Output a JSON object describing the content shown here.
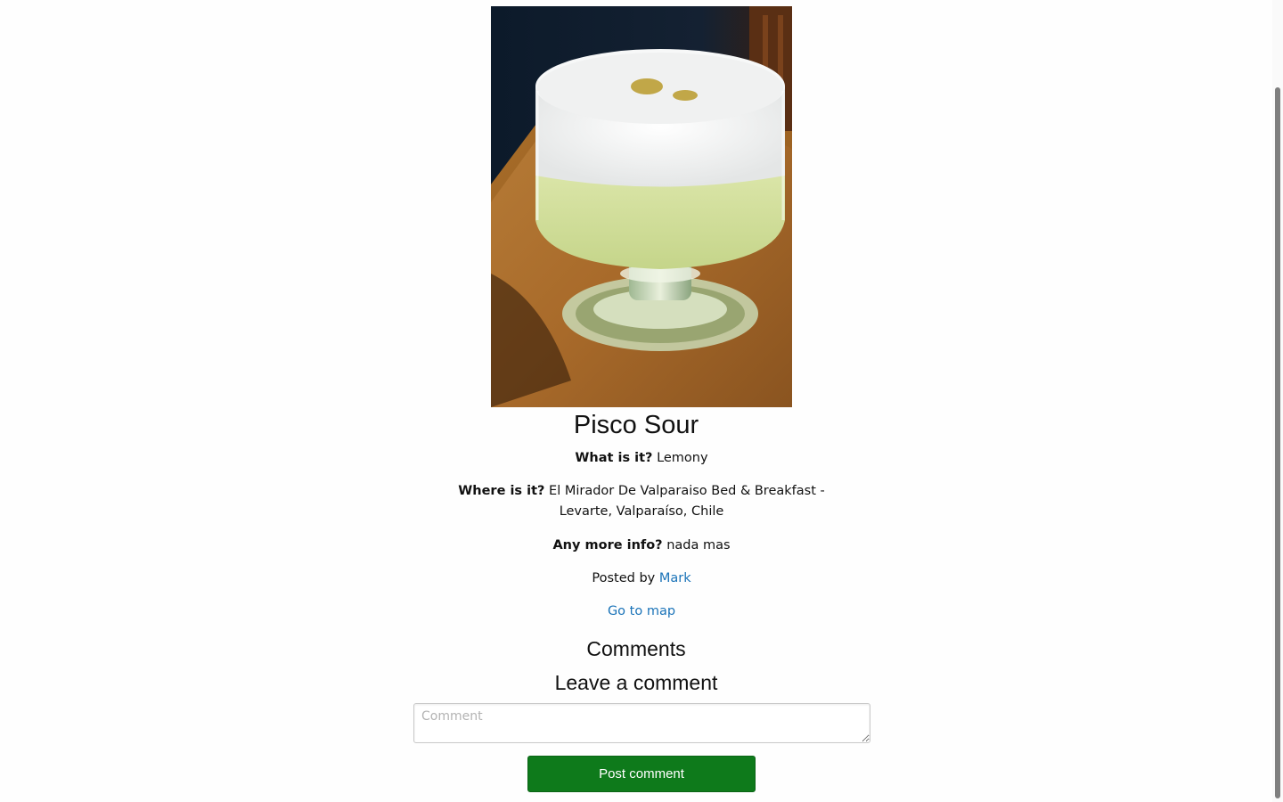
{
  "post": {
    "title": "Pisco Sour",
    "image_subject": "pisco-sour-cocktail-photo",
    "what_label": "What is it?",
    "what_value": "Lemony",
    "where_label": "Where is it?",
    "where_value": "El Mirador De Valparaiso Bed & Breakfast - Levarte, Valparaíso, Chile",
    "more_label": "Any more info?",
    "more_value": "nada mas",
    "posted_by_prefix": "Posted by",
    "author": "Mark",
    "map_link": "Go to map"
  },
  "comments": {
    "heading": "Comments",
    "form_heading": "Leave a comment",
    "placeholder": "Comment",
    "submit_label": "Post comment"
  },
  "colors": {
    "link": "#1a73b8",
    "submit_button": "#0e7a1b"
  }
}
